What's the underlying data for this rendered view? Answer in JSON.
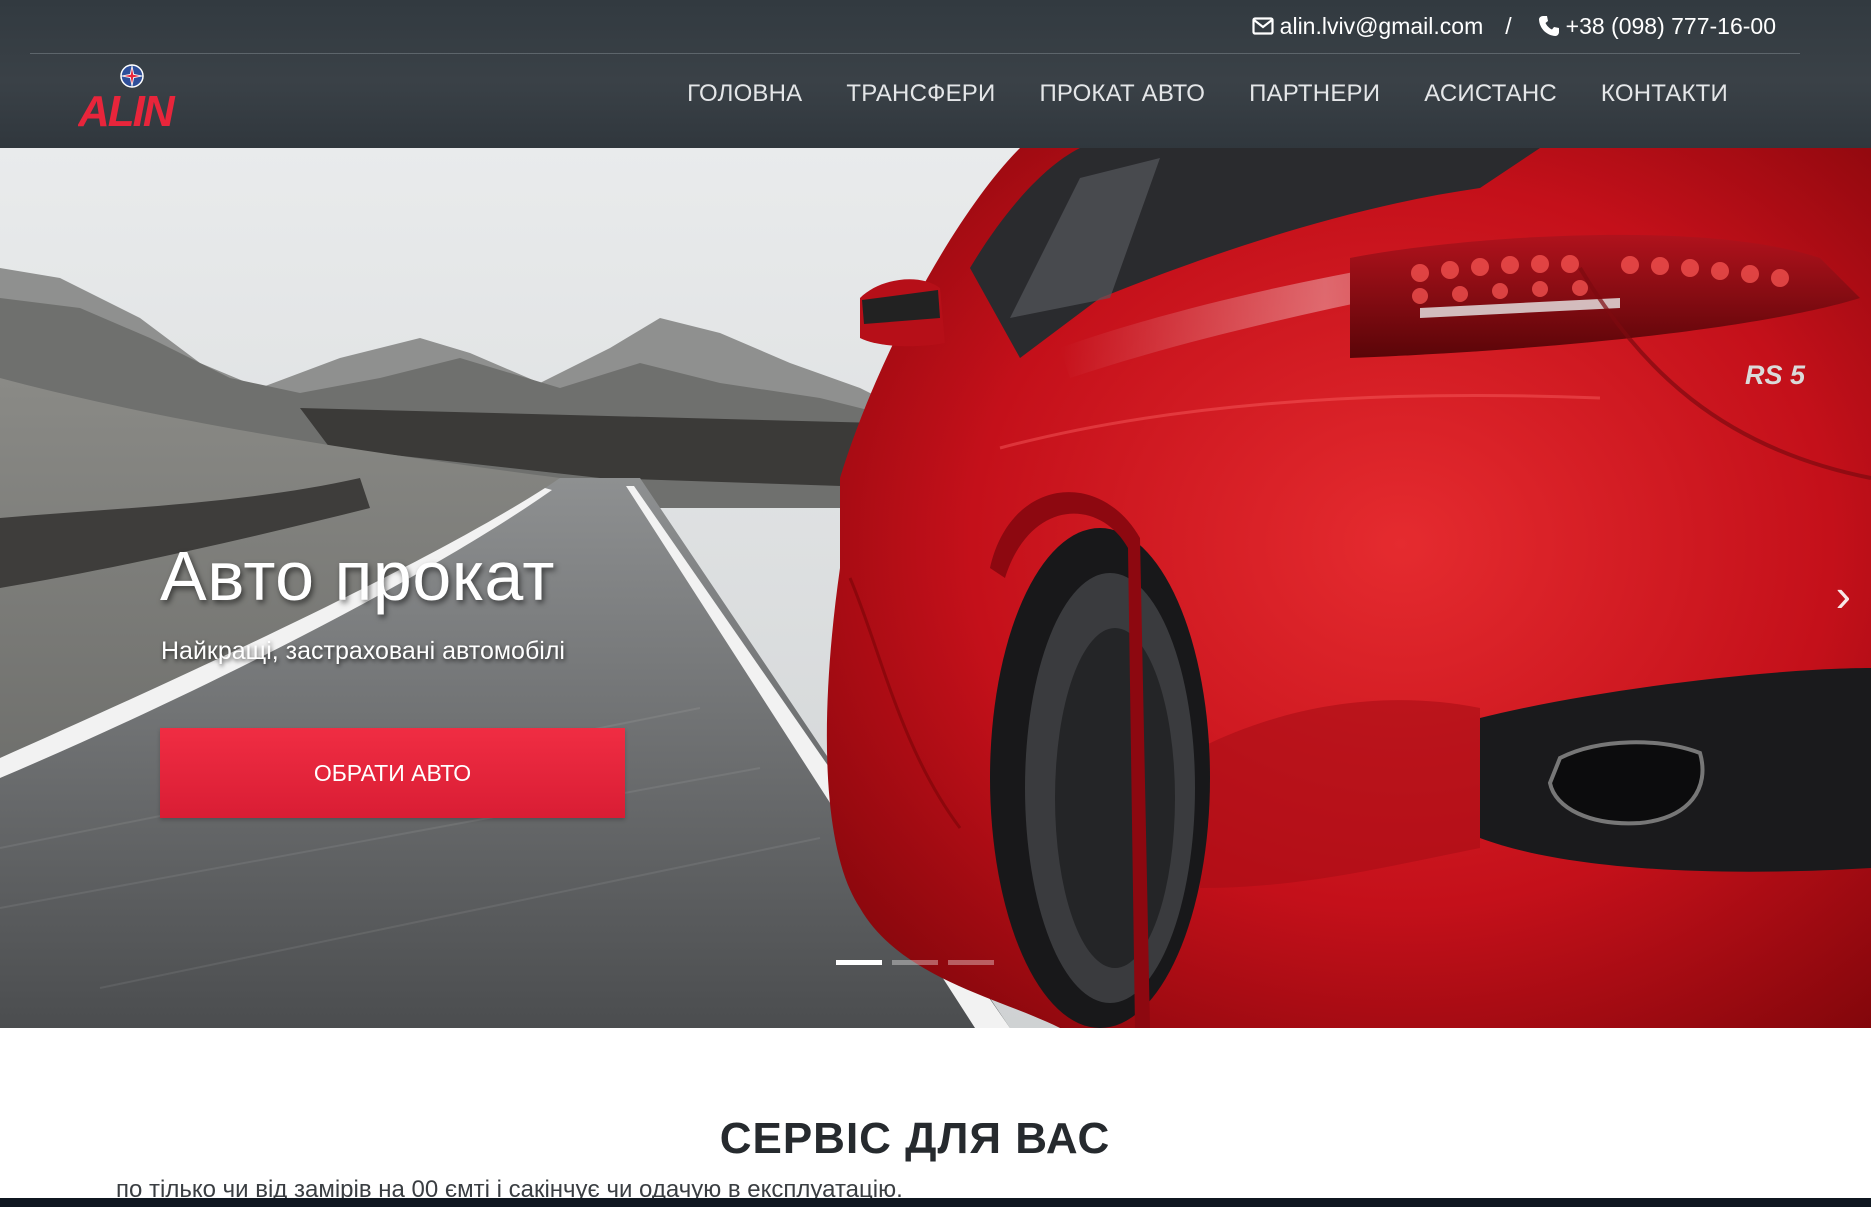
{
  "topbar": {
    "email": "alin.lviv@gmail.com",
    "separator": "/",
    "phone": "+38 (098) 777-16-00",
    "email_icon": "envelope-icon",
    "phone_icon": "phone-icon"
  },
  "logo": {
    "text": "ALIN",
    "icon": "compass-star-icon"
  },
  "nav": {
    "items": [
      {
        "label": "ГОЛОВНА"
      },
      {
        "label": "ТРАНСФЕРИ"
      },
      {
        "label": "ПРОКАТ АВТО"
      },
      {
        "label": "ПАРТНЕРИ"
      },
      {
        "label": "АСИСТАНС"
      },
      {
        "label": "КОНТАКТИ"
      }
    ]
  },
  "hero": {
    "title": "Авто прокат",
    "subtitle": "Найкращі, застраховані автомобілі",
    "button_label": "ОБРАТИ АВТО",
    "prev_icon": "chevron-left-icon",
    "next_icon": "chevron-right-icon",
    "prev_glyph": "‹",
    "next_glyph": "›",
    "image": "red-sports-car-on-mountain-road",
    "car_badge": "RS 5",
    "slides": 3,
    "active_slide": 1
  },
  "services": {
    "title": "СЕРВІС ДЛЯ ВАС",
    "cut_text": "по тілько чи від замірів на 00 ємті і сакінчує чи одачую в експлуатацію."
  },
  "colors": {
    "header_bg": "#363d43",
    "accent": "#e8253b",
    "car_red": "#c4101a"
  }
}
